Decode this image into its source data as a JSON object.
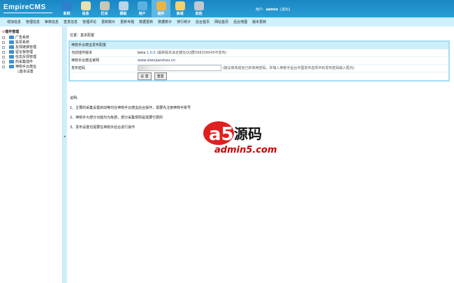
{
  "header": {
    "logo": "EmpireCMS",
    "nav": [
      {
        "label": "系统",
        "color": "#2f7fd0"
      },
      {
        "label": "信息",
        "color": "#e8e0b0"
      },
      {
        "label": "栏目",
        "color": "#c9c7b8"
      },
      {
        "label": "模板",
        "color": "#b9d6e8"
      },
      {
        "label": "用户",
        "color": "#5ab1e0"
      },
      {
        "label": "插件",
        "color": "#e9b54a",
        "active": true
      },
      {
        "label": "商城",
        "color": "#f3d070"
      },
      {
        "label": "其他",
        "color": "#c0c8d0"
      }
    ],
    "user_label": "用户:",
    "user": "admin",
    "logout": "[退出]"
  },
  "subnav": [
    "增加信息",
    "管理信息",
    "审核信息",
    "签发信息",
    "管理评论",
    "更新数片",
    "更新专题",
    "数据更新",
    "数据统计",
    "排行统计",
    "后台首页",
    "网站首页",
    "后台地图",
    "版本更新"
  ],
  "sidebar": {
    "root": "插件管理",
    "items": [
      "广告系统",
      "投票系统",
      "友情链接管理",
      "留言板管理",
      "信息反馈管理",
      "药采集插件",
      "神箭手云爬虫"
    ],
    "child": "基本设置"
  },
  "main": {
    "breadcrumb": "位置：基本配置",
    "table": {
      "title": "神箭手云爬虫发布配置",
      "rows": [
        {
          "label": "当前插件版本",
          "value_prefix": "beta",
          "value": "1.0.0",
          "note": "(最新版本会定期在QQ群568258045中发布)"
        },
        {
          "label": "神箭手云爬虫官网",
          "value": "www.shenjianshou.cn"
        },
        {
          "label": "发布密码",
          "value": "",
          "note": "(建议修改成自己的常用密码，并填入神箭手后台中国发布选项中的发布密码输入框内)"
        }
      ],
      "submit": "设 置",
      "reset": "重置"
    },
    "notes_title": "说明:",
    "notes": [
      "1、主要的采集设置启动等均在神箭手云爬虫后台操作，需要先注册神箭手账号",
      "2、神箭手大部分功能均为免费，部分采集规则是需要付费的",
      "3、发布设置也需要在神箭手后台进行操作"
    ]
  },
  "watermark": {
    "brand": "a5源码",
    "url": "admin5.com"
  }
}
